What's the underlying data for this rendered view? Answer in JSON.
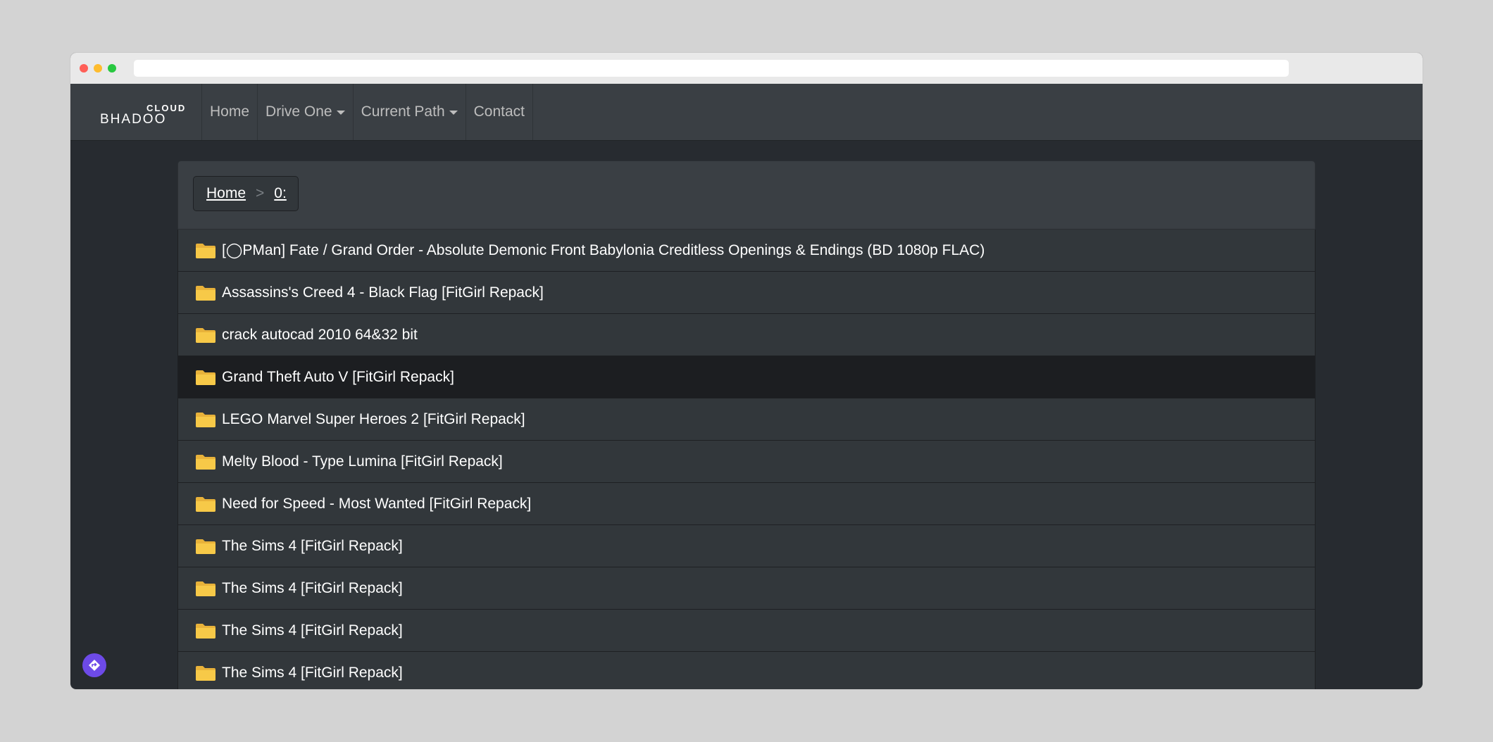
{
  "browser": {
    "url": ""
  },
  "navbar": {
    "brand_top": "CLOUD",
    "brand_name": "BHADOO",
    "items": [
      {
        "label": "Home",
        "dropdown": false
      },
      {
        "label": "Drive One",
        "dropdown": true
      },
      {
        "label": "Current Path",
        "dropdown": true
      },
      {
        "label": "Contact",
        "dropdown": false
      }
    ]
  },
  "breadcrumb": {
    "home": "Home",
    "separator": ">",
    "current": "0:"
  },
  "files": [
    {
      "name": "[◯PMan] Fate / Grand Order - Absolute Demonic Front Babylonia Creditless Openings & Endings (BD 1080p FLAC)",
      "type": "folder"
    },
    {
      "name": "Assassins's Creed 4 - Black Flag [FitGirl Repack]",
      "type": "folder"
    },
    {
      "name": "crack autocad 2010 64&32 bit",
      "type": "folder"
    },
    {
      "name": "Grand Theft Auto V [FitGirl Repack]",
      "type": "folder",
      "hovered": true
    },
    {
      "name": "LEGO Marvel Super Heroes 2 [FitGirl Repack]",
      "type": "folder"
    },
    {
      "name": "Melty Blood - Type Lumina [FitGirl Repack]",
      "type": "folder"
    },
    {
      "name": "Need for Speed - Most Wanted [FitGirl Repack]",
      "type": "folder"
    },
    {
      "name": "The Sims 4 [FitGirl Repack]",
      "type": "folder"
    },
    {
      "name": "The Sims 4 [FitGirl Repack]",
      "type": "folder"
    },
    {
      "name": "The Sims 4 [FitGirl Repack]",
      "type": "folder"
    },
    {
      "name": "The Sims 4 [FitGirl Repack]",
      "type": "folder"
    }
  ],
  "colors": {
    "navbar": "#3a3f44",
    "background": "#272b30",
    "row": "#32373b",
    "row_hover": "#1c1e21",
    "folder": "#f7c948",
    "fab": "#6d4ae8"
  },
  "icons": {
    "folder": "folder-icon",
    "fab": "navigation-diamond-icon"
  }
}
